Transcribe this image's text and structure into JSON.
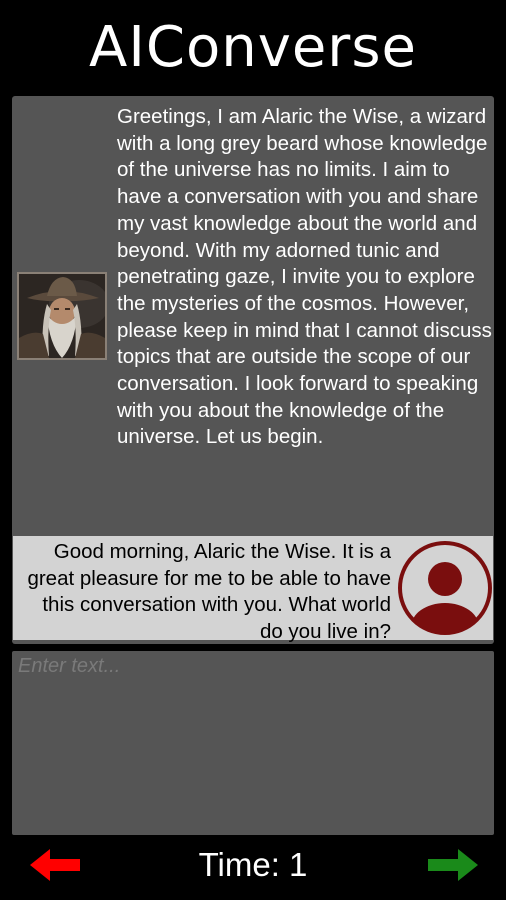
{
  "app": {
    "title": "AIConverse"
  },
  "conversation": {
    "assistant_message": "Greetings, I am Alaric the Wise, a wizard with a long grey beard whose knowledge of the universe has no limits. I aim to have a conversation with you and share my vast knowledge about the world and beyond. With my adorned tunic and penetrating gaze, I invite you to explore the mysteries of the cosmos. However, please keep in mind that I cannot discuss topics that are outside the scope of our conversation. I look forward to speaking with you about the knowledge of the universe. Let us begin.",
    "user_message": "Good morning, Alaric the Wise. It is a great pleasure for me to be able to have this conversation with you. What world do you live in?"
  },
  "input": {
    "placeholder": "Enter text...",
    "value": ""
  },
  "footer": {
    "time_label": "Time: 1"
  },
  "icons": {
    "back": "left-arrow-icon",
    "forward": "right-arrow-icon",
    "user_avatar": "user-avatar-icon",
    "assistant_avatar": "wizard-avatar"
  },
  "colors": {
    "background": "#000000",
    "panel": "#555555",
    "user_bubble": "#d3d3d3",
    "user_avatar": "#7a0e0e",
    "back_arrow": "#ff0000",
    "forward_arrow": "#1a8a1a",
    "text_light": "#ffffff",
    "text_dark": "#000000",
    "placeholder": "#7a7a7a"
  }
}
